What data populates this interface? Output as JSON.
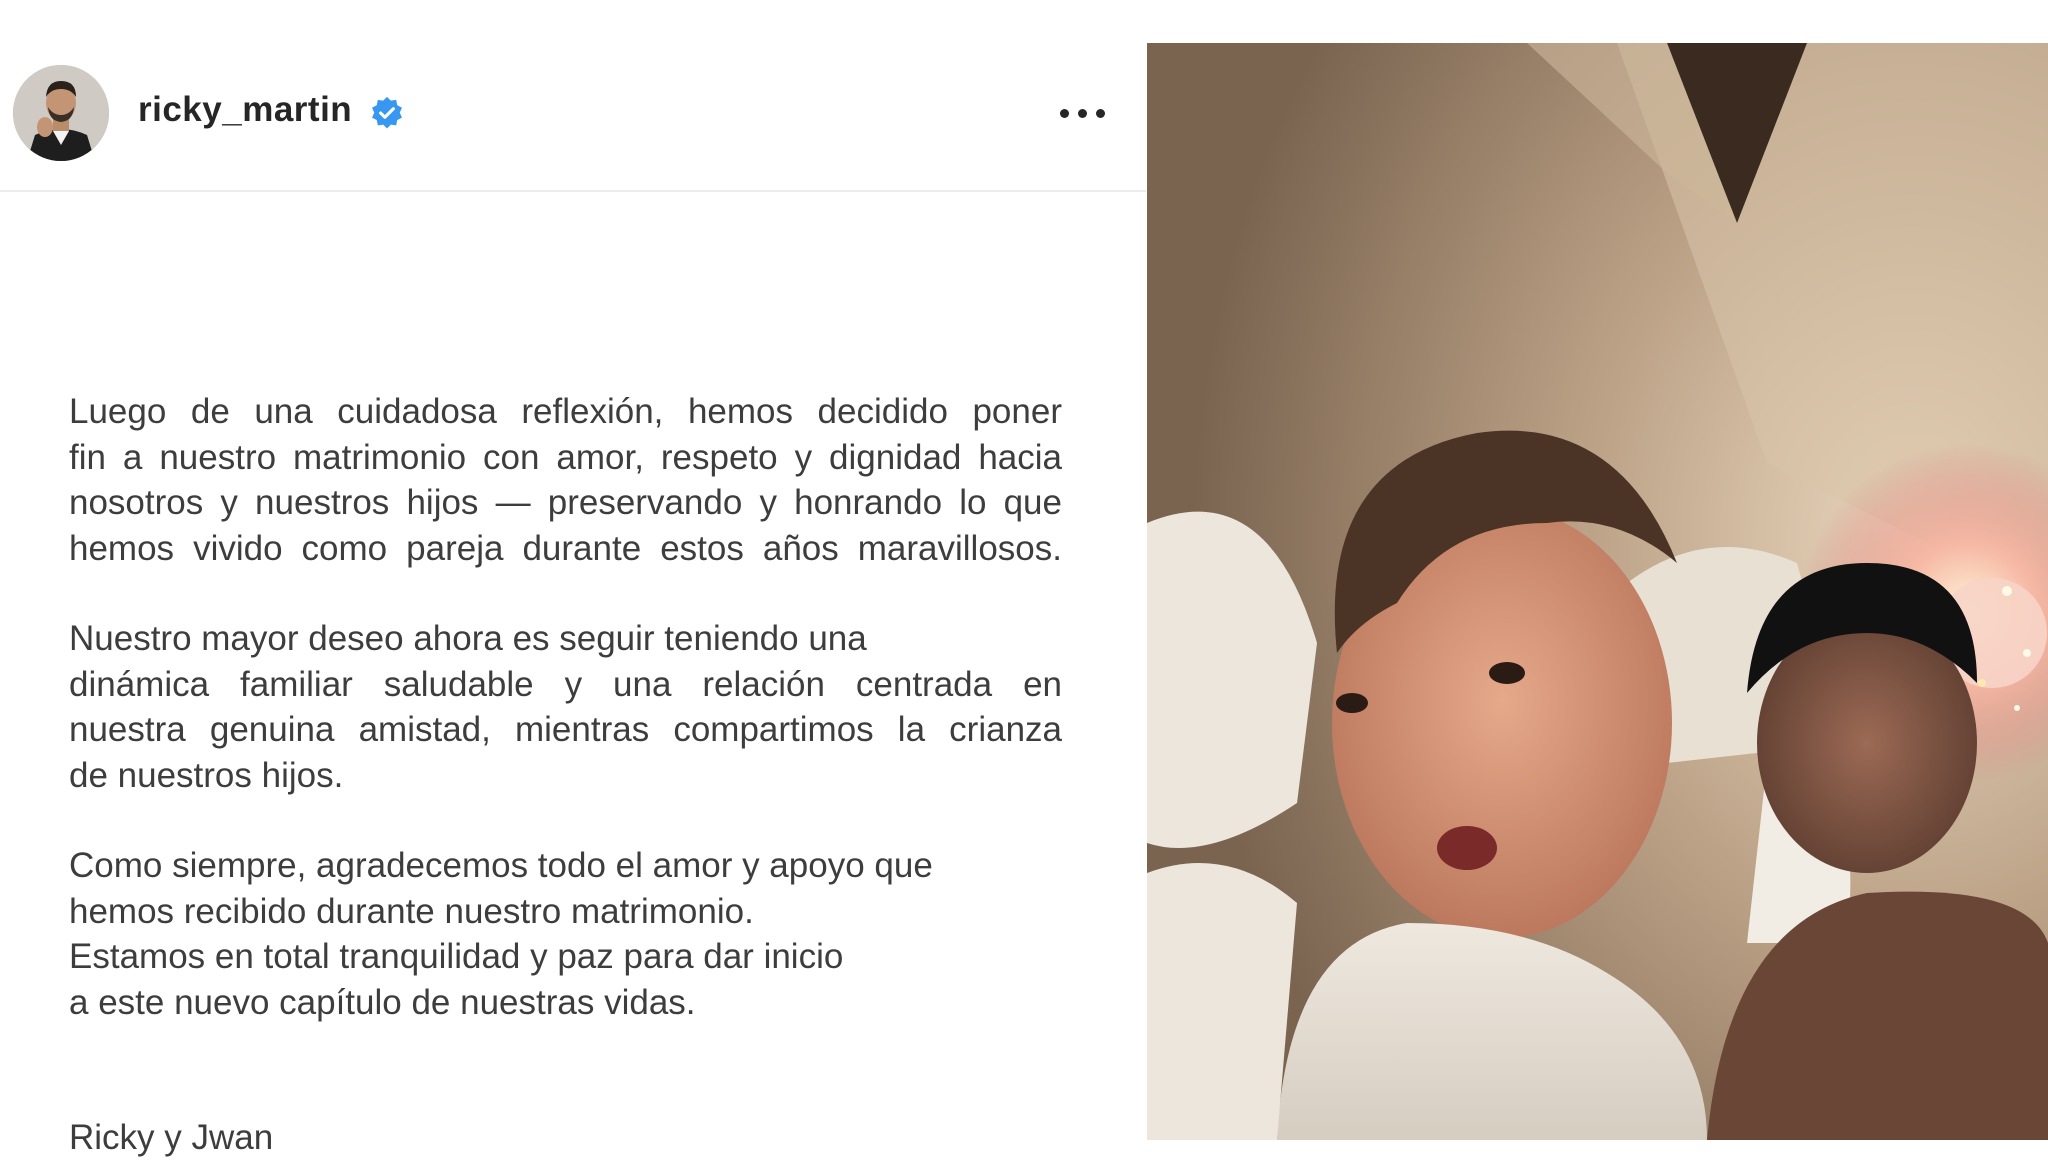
{
  "header": {
    "username": "ricky_martin",
    "verified": true
  },
  "statement": {
    "paragraph_1": [
      "Luego de una cuidadosa reflexión, hemos decidido poner",
      "fin a nuestro matrimonio con amor, respeto y dignidad hacia",
      "nosotros y nuestros hijos — preservando y honrando lo que",
      "hemos vivido como pareja durante estos años maravillosos."
    ],
    "paragraph_2": [
      "Nuestro mayor deseo ahora es seguir teniendo una",
      "dinámica familiar saludable y una relación centrada en",
      "nuestra genuina amistad, mientras compartimos la crianza",
      "de nuestros hijos."
    ],
    "paragraph_3": [
      "Como siempre, agradecemos todo el amor y apoyo que",
      "hemos recibido durante nuestro matrimonio.",
      "Estamos en total tranquilidad y paz para dar inicio",
      "a este nuevo capítulo de nuestras vidas."
    ],
    "signature": "Ricky y Jwan"
  },
  "icons": {
    "verified_badge": "verified-badge-icon",
    "more_options": "more-options-icon"
  },
  "colors": {
    "text_primary": "#262626",
    "text_body": "#3d3d3d",
    "verified_blue": "#3897f0",
    "divider": "#ececec"
  }
}
